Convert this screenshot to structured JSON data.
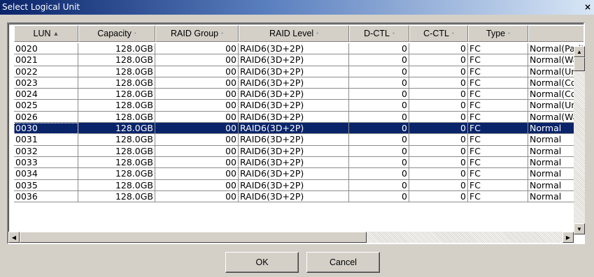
{
  "window": {
    "title": "Select Logical Unit",
    "close_label": "×"
  },
  "columns": [
    {
      "label": "LUN",
      "sort": "▲"
    },
    {
      "label": "Capacity",
      "sort": "▪"
    },
    {
      "label": "RAID Group",
      "sort": "▪"
    },
    {
      "label": "RAID Level",
      "sort": "▪"
    },
    {
      "label": "D-CTL",
      "sort": "▪"
    },
    {
      "label": "C-CTL",
      "sort": "▪"
    },
    {
      "label": "Type",
      "sort": "▪"
    },
    {
      "label": "",
      "sort": ""
    }
  ],
  "rows": [
    [
      "0020",
      "128.0GB",
      "00",
      "RAID6(3D+2P)",
      "0",
      "0",
      "FC",
      "Normal(Parit"
    ],
    [
      "0021",
      "128.0GB",
      "00",
      "RAID6(3D+2P)",
      "0",
      "0",
      "FC",
      "Normal(Waiti"
    ],
    [
      "0022",
      "128.0GB",
      "00",
      "RAID6(3D+2P)",
      "0",
      "0",
      "FC",
      "Normal(Uncc"
    ],
    [
      "0023",
      "128.0GB",
      "00",
      "RAID6(3D+2P)",
      "0",
      "0",
      "FC",
      "Normal(Corre"
    ],
    [
      "0024",
      "128.0GB",
      "00",
      "RAID6(3D+2P)",
      "0",
      "0",
      "FC",
      "Normal(Corre"
    ],
    [
      "0025",
      "128.0GB",
      "00",
      "RAID6(3D+2P)",
      "0",
      "0",
      "FC",
      "Normal(Uncc"
    ],
    [
      "0026",
      "128.0GB",
      "00",
      "RAID6(3D+2P)",
      "0",
      "0",
      "FC",
      "Normal(Waiti"
    ],
    [
      "0030",
      "128.0GB",
      "00",
      "RAID6(3D+2P)",
      "0",
      "0",
      "FC",
      "Normal"
    ],
    [
      "0031",
      "128.0GB",
      "00",
      "RAID6(3D+2P)",
      "0",
      "0",
      "FC",
      "Normal"
    ],
    [
      "0032",
      "128.0GB",
      "00",
      "RAID6(3D+2P)",
      "0",
      "0",
      "FC",
      "Normal"
    ],
    [
      "0033",
      "128.0GB",
      "00",
      "RAID6(3D+2P)",
      "0",
      "0",
      "FC",
      "Normal"
    ],
    [
      "0034",
      "128.0GB",
      "00",
      "RAID6(3D+2P)",
      "0",
      "0",
      "FC",
      "Normal"
    ],
    [
      "0035",
      "128.0GB",
      "00",
      "RAID6(3D+2P)",
      "0",
      "0",
      "FC",
      "Normal"
    ],
    [
      "0036",
      "128.0GB",
      "00",
      "RAID6(3D+2P)",
      "0",
      "0",
      "FC",
      "Normal"
    ]
  ],
  "selected_row": "0030",
  "buttons": {
    "ok": "OK",
    "cancel": "Cancel"
  },
  "icons": {
    "close": "close-icon",
    "scroll_up": "arrow-up-icon",
    "scroll_down": "arrow-down-icon",
    "scroll_left": "arrow-left-icon",
    "scroll_right": "arrow-right-icon"
  },
  "colors": {
    "title_bar": "#0a246a",
    "selection": "#0a246a",
    "window_bg": "#d4d0c8"
  }
}
